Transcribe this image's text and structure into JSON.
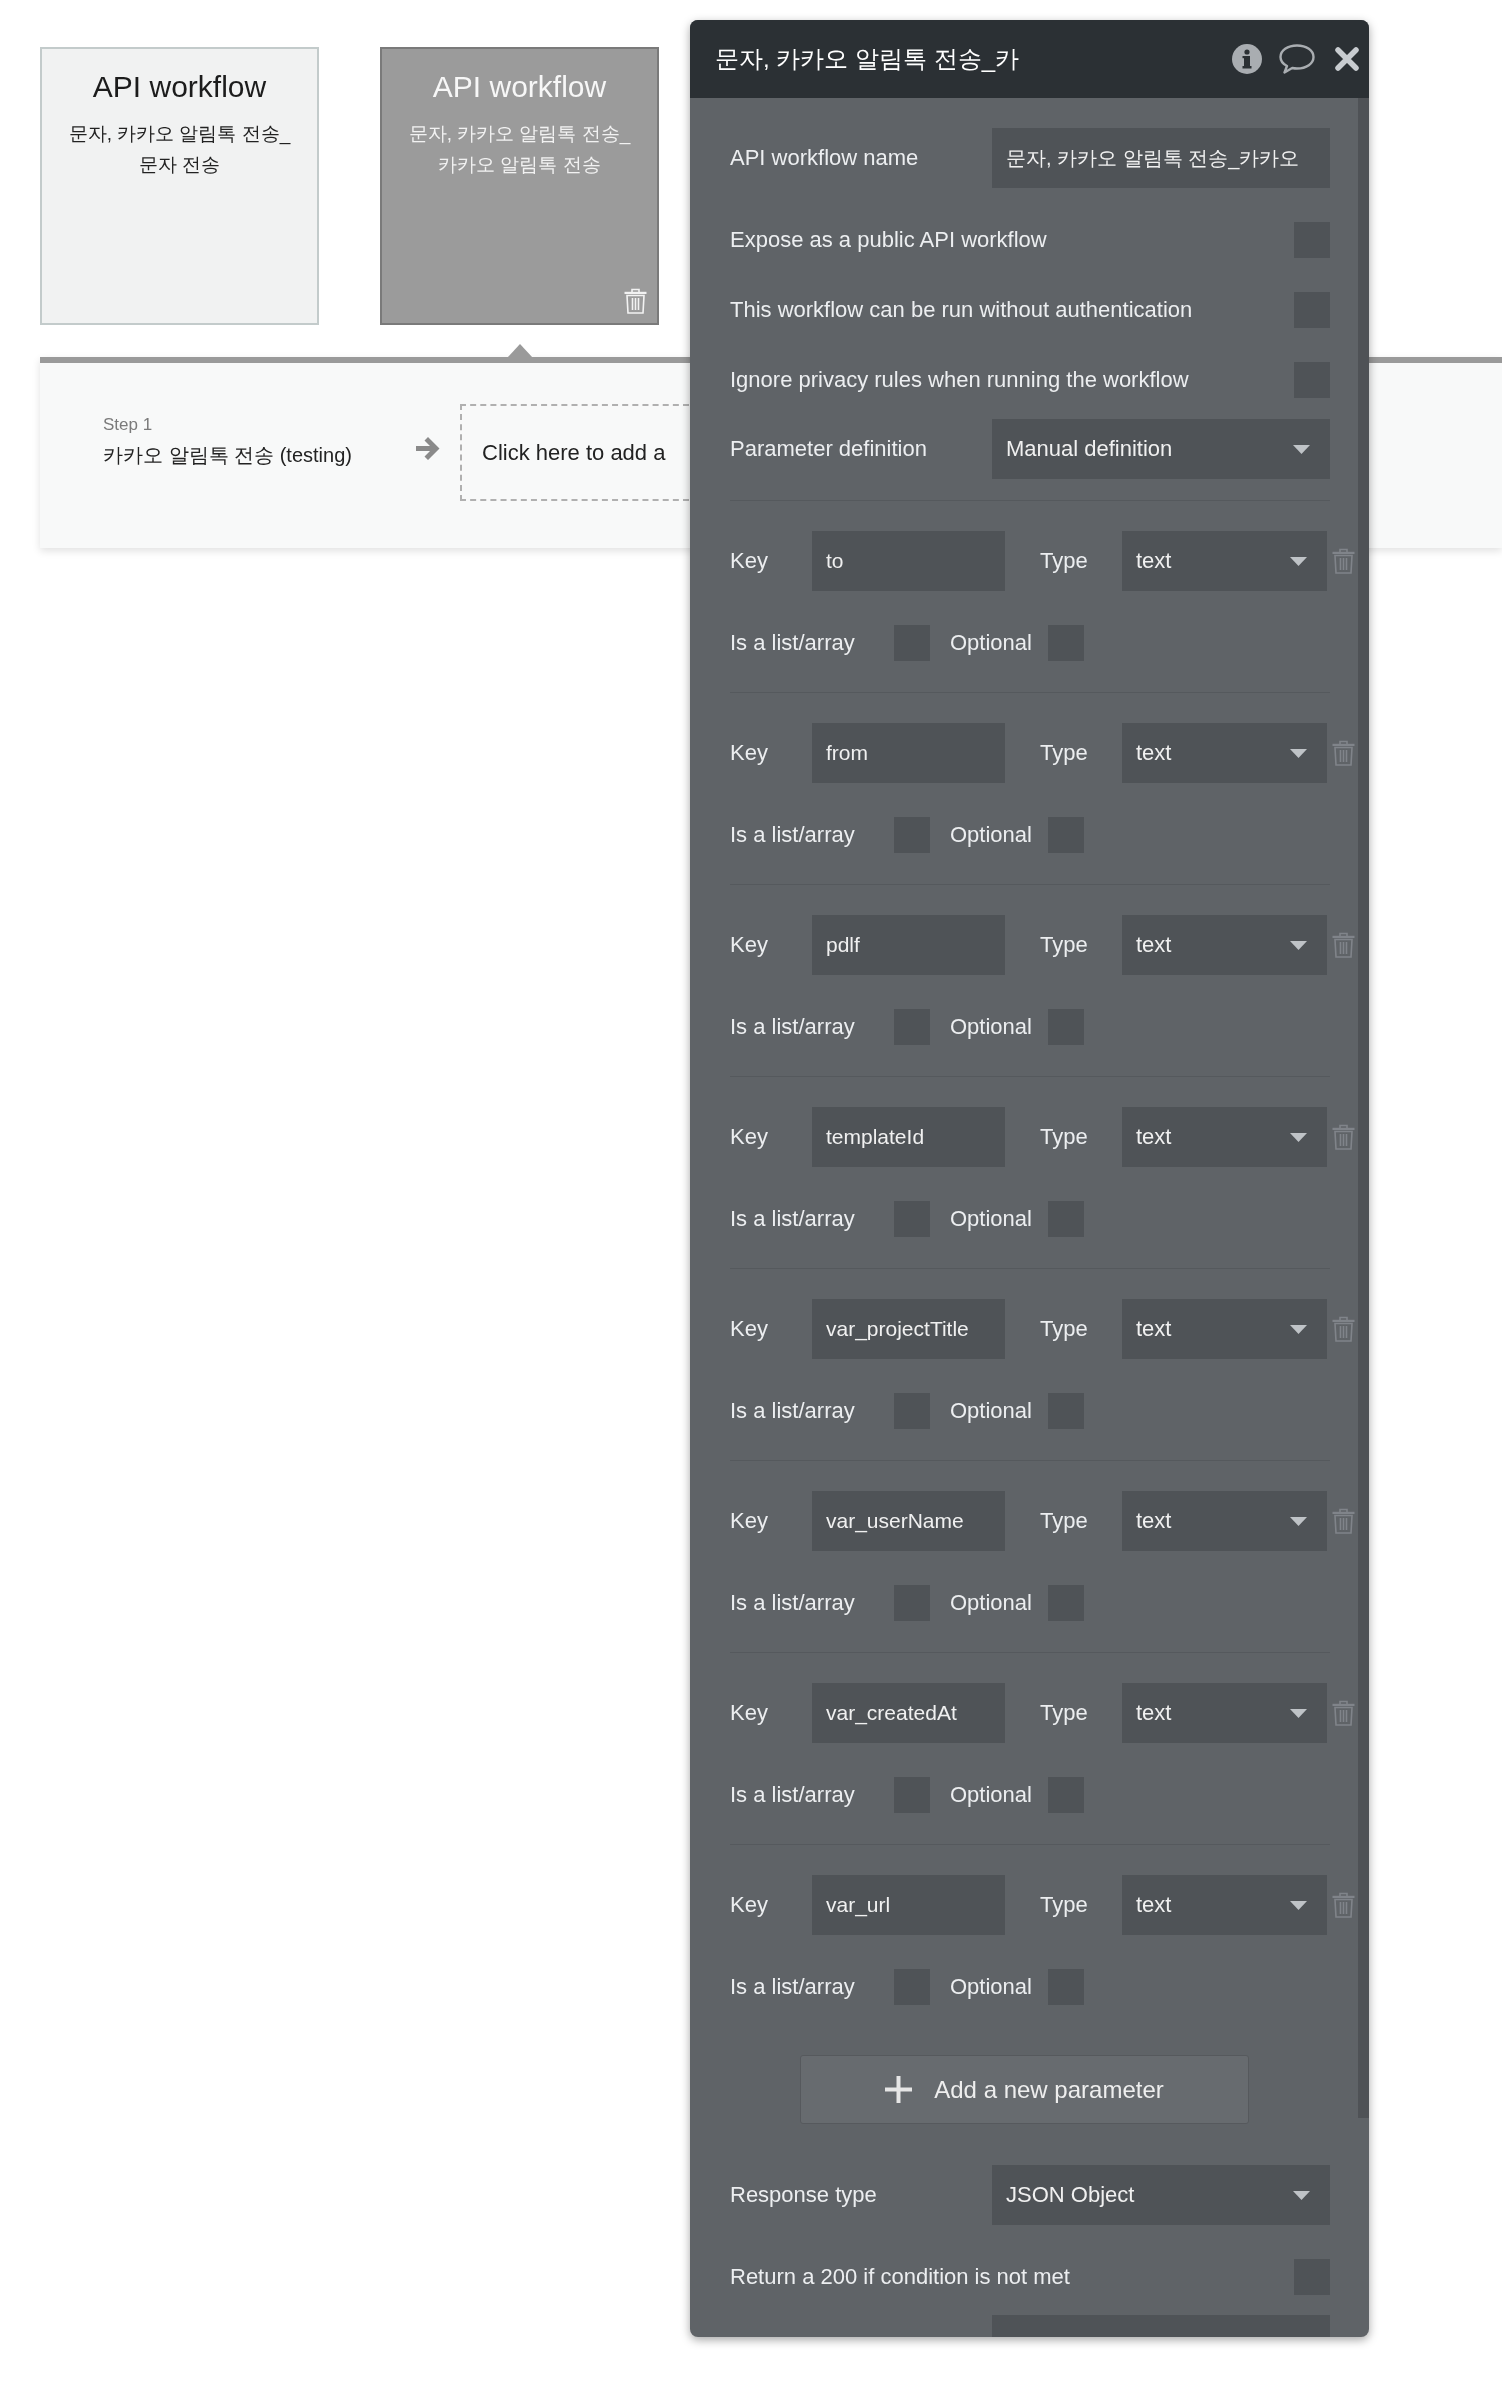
{
  "canvas": {
    "workflow_cards": [
      {
        "title": "API workflow",
        "name_lines": [
          "문자, 카카오 알림톡 전송_",
          "문자 전송"
        ],
        "selected": false
      },
      {
        "title": "API workflow",
        "name_lines": [
          "문자, 카카오 알림톡 전송_",
          "카카오 알림톡 전송"
        ],
        "selected": true
      }
    ],
    "steps": [
      {
        "label": "Step 1",
        "action": "카카오 알림톡 전송 (testing)"
      }
    ],
    "add_action": "Click here to add a"
  },
  "panel": {
    "title": "문자, 카카오 알림톡 전송_카",
    "fields": [
      {
        "kind": "text",
        "label": "API workflow name",
        "value": "문자, 카카오 알림톡 전송_카카오"
      },
      {
        "kind": "checkbox",
        "label": "Expose as a public API workflow",
        "checked": false
      },
      {
        "kind": "checkbox",
        "label": "This workflow can be run without authentication",
        "checked": false
      },
      {
        "kind": "checkbox",
        "label": "Ignore privacy rules when running the workflow",
        "checked": false
      },
      {
        "kind": "dropdown",
        "label": "Parameter definition",
        "value": "Manual definition"
      }
    ],
    "parameters": [
      {
        "key_label": "Key",
        "key": "to",
        "type_label": "Type",
        "type": "text",
        "list_label": "Is a list/array",
        "is_list": false,
        "optional_label": "Optional",
        "optional": false
      },
      {
        "key_label": "Key",
        "key": "from",
        "type_label": "Type",
        "type": "text",
        "list_label": "Is a list/array",
        "is_list": false,
        "optional_label": "Optional",
        "optional": false
      },
      {
        "key_label": "Key",
        "key": "pdlf",
        "type_label": "Type",
        "type": "text",
        "list_label": "Is a list/array",
        "is_list": false,
        "optional_label": "Optional",
        "optional": false
      },
      {
        "key_label": "Key",
        "key": "templateId",
        "type_label": "Type",
        "type": "text",
        "list_label": "Is a list/array",
        "is_list": false,
        "optional_label": "Optional",
        "optional": false
      },
      {
        "key_label": "Key",
        "key": "var_projectTitle",
        "type_label": "Type",
        "type": "text",
        "list_label": "Is a list/array",
        "is_list": false,
        "optional_label": "Optional",
        "optional": false
      },
      {
        "key_label": "Key",
        "key": "var_userName",
        "type_label": "Type",
        "type": "text",
        "list_label": "Is a list/array",
        "is_list": false,
        "optional_label": "Optional",
        "optional": false
      },
      {
        "key_label": "Key",
        "key": "var_createdAt",
        "type_label": "Type",
        "type": "text",
        "list_label": "Is a list/array",
        "is_list": false,
        "optional_label": "Optional",
        "optional": false
      },
      {
        "key_label": "Key",
        "key": "var_url",
        "type_label": "Type",
        "type": "text",
        "list_label": "Is a list/array",
        "is_list": false,
        "optional_label": "Optional",
        "optional": false
      }
    ],
    "add_button": "Add a new parameter",
    "settings": [
      {
        "kind": "dropdown",
        "label": "Response type",
        "value": "JSON Object"
      },
      {
        "kind": "checkbox",
        "label": "Return a 200 if condition is not met",
        "checked": false
      }
    ]
  }
}
